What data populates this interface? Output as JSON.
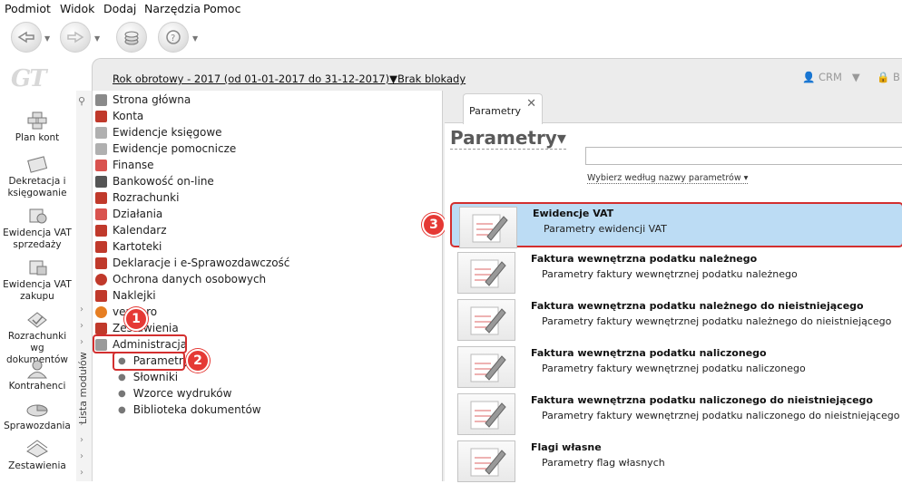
{
  "menu": [
    "Podmiot",
    "Widok",
    "Dodaj",
    "Narzędzia",
    "Pomoc"
  ],
  "logo": "GT",
  "header": {
    "year": "Rok obrotowy - 2017  (od 01-01-2017 do 31-12-2017)",
    "lock": "Brak blokady",
    "crm": "CRM",
    "b": "B"
  },
  "leftnav": [
    {
      "label": "Plan kont",
      "icon": "chart-of-accounts-icon"
    },
    {
      "label": "Dekretacja i księgowanie",
      "icon": "booking-icon"
    },
    {
      "label": "Ewidencja VAT sprzedaży",
      "icon": "vat-sales-icon"
    },
    {
      "label": "Ewidencja VAT zakupu",
      "icon": "vat-purchase-icon"
    },
    {
      "label": "Rozrachunki wg dokumentów",
      "icon": "settlements-icon"
    },
    {
      "label": "Kontrahenci",
      "icon": "contractors-icon"
    },
    {
      "label": "Sprawozdania",
      "icon": "reports-icon"
    },
    {
      "label": "Zestawienia",
      "icon": "statements-icon"
    }
  ],
  "sidebar_label": "Lista modułów",
  "tree": [
    {
      "label": "Strona główna",
      "color": "#8a8a8a"
    },
    {
      "label": "Konta",
      "color": "#c0392b"
    },
    {
      "label": "Ewidencje księgowe",
      "color": "#b0b0b0"
    },
    {
      "label": "Ewidencje pomocnicze",
      "color": "#b0b0b0"
    },
    {
      "label": "Finanse",
      "color": "#d9534f"
    },
    {
      "label": "Bankowość on-line",
      "color": "#555555"
    },
    {
      "label": "Rozrachunki",
      "color": "#c0392b"
    },
    {
      "label": "Działania",
      "color": "#d9534f"
    },
    {
      "label": "Kalendarz",
      "color": "#c0392b"
    },
    {
      "label": "Kartoteki",
      "color": "#c0392b"
    },
    {
      "label": "Deklaracje i e-Sprawozdawczość",
      "color": "#c0392b"
    },
    {
      "label": "Ochrona danych osobowych",
      "color": "#c0392b"
    },
    {
      "label": "Naklejki",
      "color": "#c0392b"
    },
    {
      "label": "vendero",
      "color": "#e67e22"
    },
    {
      "label": "Zestawienia",
      "color": "#c0392b"
    },
    {
      "label": "Administracja",
      "color": "#9a9a9a"
    }
  ],
  "subitems": [
    "Parametry",
    "Słowniki",
    "Wzorce wydruków",
    "Biblioteka dokumentów"
  ],
  "badges": [
    "1",
    "2",
    "3"
  ],
  "tab": {
    "label": "Parametry",
    "close": "✕"
  },
  "page": {
    "title": "Parametry▾",
    "by_label": "Wybierz według nazwy parametrów ▾",
    "search_value": ""
  },
  "params": [
    {
      "title": "Ewidencje VAT",
      "desc": "Parametry ewidencji VAT"
    },
    {
      "title": "Faktura wewnętrzna podatku należnego",
      "desc": "Parametry faktury wewnętrznej podatku należnego"
    },
    {
      "title": "Faktura wewnętrzna podatku należnego do nieistniejącego",
      "desc": "Parametry faktury wewnętrznej podatku należnego do nieistniejącego"
    },
    {
      "title": "Faktura wewnętrzna podatku naliczonego",
      "desc": "Parametry faktury wewnętrznej podatku naliczonego"
    },
    {
      "title": "Faktura wewnętrzna podatku naliczonego do nieistniejącego",
      "desc": "Parametry faktury wewnętrznej podatku naliczonego do nieistniejącego"
    },
    {
      "title": "Flagi własne",
      "desc": "Parametry flag własnych"
    }
  ],
  "colors": {
    "selected": "#bcdcf4",
    "highlight": "#d32f2f",
    "badge": "#e53935"
  }
}
